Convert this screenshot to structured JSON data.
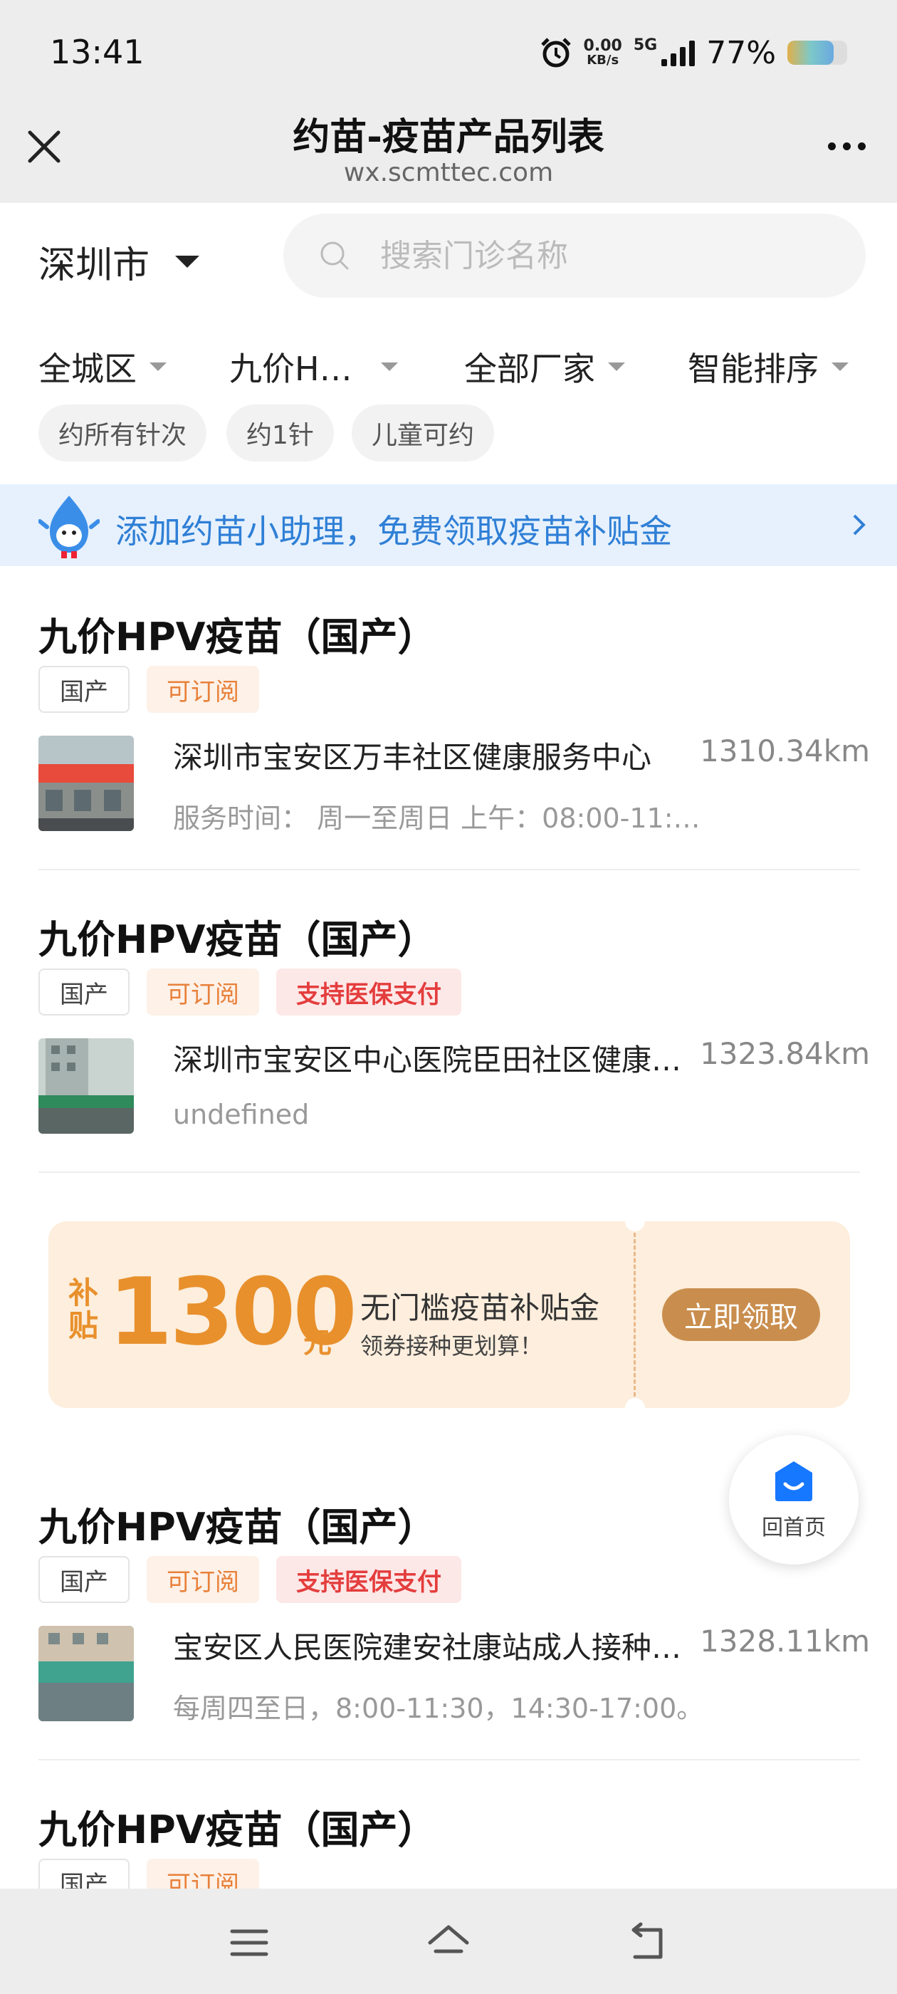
{
  "status_bar": {
    "time": "13:41",
    "net_speed": "0.00",
    "net_unit": "KB/s",
    "network": "5G",
    "battery_text": "77%",
    "battery_level": 0.77
  },
  "header": {
    "title": "约苗-疫苗产品列表",
    "domain": "wx.scmttec.com"
  },
  "search": {
    "city": "深圳市",
    "placeholder": "搜索门诊名称"
  },
  "filters": [
    "全城区",
    "九价H…",
    "全部厂家",
    "智能排序"
  ],
  "chips": [
    "约所有针次",
    "约1针",
    "儿童可约"
  ],
  "banner": {
    "text": "添加约苗小助理，免费领取疫苗补贴金"
  },
  "cards": [
    {
      "title": "九价HPV疫苗（国产）",
      "tags": [
        "国产",
        "可订阅"
      ],
      "clinic": "深圳市宝安区万丰社区健康服务中心",
      "distance": "1310.34km",
      "hours": "服务时间：  周一至周日 上午：08:00-11:…"
    },
    {
      "title": "九价HPV疫苗（国产）",
      "tags": [
        "国产",
        "可订阅",
        "支持医保支付"
      ],
      "clinic": "深圳市宝安区中心医院臣田社区健康…",
      "distance": "1323.84km",
      "hours": "undefined"
    },
    {
      "title": "九价HPV疫苗（国产）",
      "tags": [
        "国产",
        "可订阅",
        "支持医保支付"
      ],
      "clinic": "宝安区人民医院建安社康站成人接种…",
      "distance": "1328.11km",
      "hours": "每周四至日，8:00-11:30，14:30-17:00。"
    },
    {
      "title": "九价HPV疫苗（国产）",
      "tags": [
        "国产",
        "可订阅"
      ]
    }
  ],
  "subsidy": {
    "label": "补贴",
    "amount": "1300",
    "unit": "元",
    "line1": "无门槛疫苗补贴金",
    "line2": "领券接种更划算！",
    "button": "立即领取"
  },
  "home_button": {
    "label": "回首页"
  },
  "colors": {
    "accent_blue": "#2f7fd6",
    "orange": "#e8813a",
    "red": "#e43d3d",
    "gold": "#c98e4e"
  }
}
